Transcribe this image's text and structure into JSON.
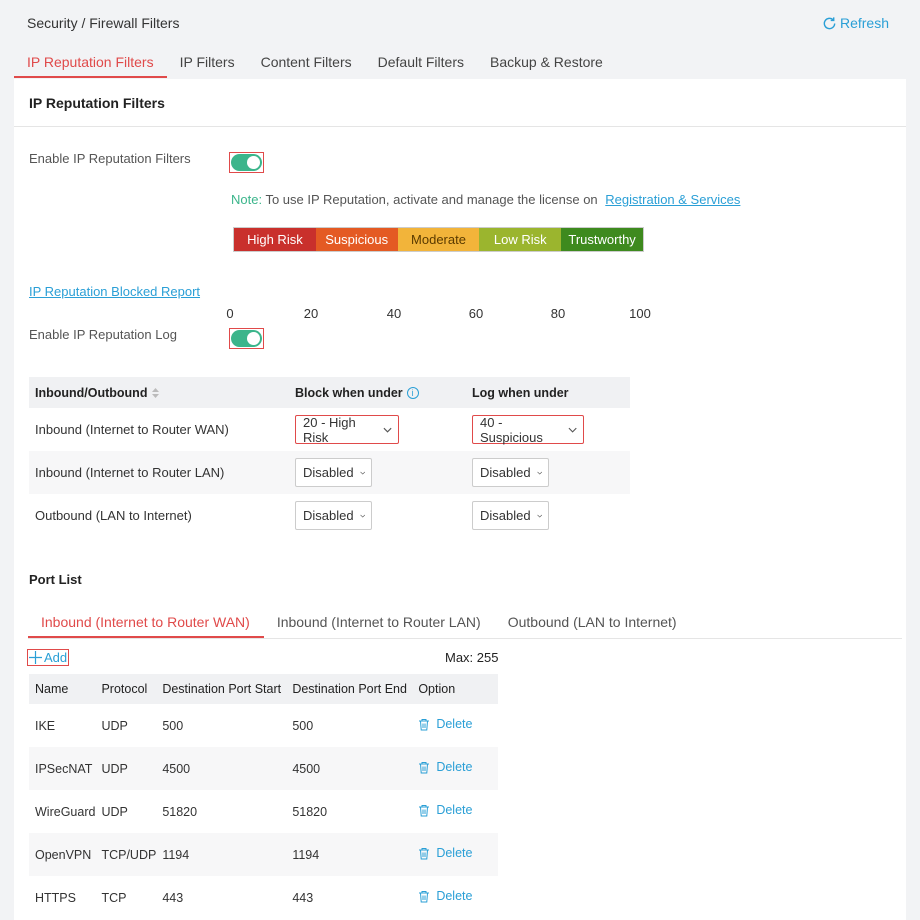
{
  "header": {
    "breadcrumb": "Security / Firewall Filters",
    "refresh_label": "Refresh"
  },
  "tabs": [
    {
      "label": "IP Reputation Filters",
      "active": true
    },
    {
      "label": "IP Filters"
    },
    {
      "label": "Content Filters"
    },
    {
      "label": "Default Filters"
    },
    {
      "label": "Backup & Restore"
    }
  ],
  "panel": {
    "title": "IP Reputation Filters",
    "enable_label": "Enable IP Reputation Filters",
    "enable_on": true,
    "note_key": "Note:",
    "note_text": " To use IP Reputation, activate and manage the license on ",
    "note_link": "Registration & Services",
    "scale": {
      "segments": [
        {
          "label": "High Risk",
          "color": "#c9302c"
        },
        {
          "label": "Suspicious",
          "color": "#e45a23"
        },
        {
          "label": "Moderate",
          "color": "#f2b43a"
        },
        {
          "label": "Low Risk",
          "color": "#9bb52e"
        },
        {
          "label": "Trustworthy",
          "color": "#3e8a1e"
        }
      ],
      "ticks": [
        "0",
        "20",
        "40",
        "60",
        "80",
        "100"
      ]
    },
    "blocked_report_link": "IP Reputation Blocked Report",
    "log_label": "Enable IP Reputation Log",
    "log_on": true
  },
  "reputation_table": {
    "headers": [
      "Inbound/Outbound",
      "Block when under",
      "Log when under"
    ],
    "rows": [
      {
        "direction": "Inbound (Internet to Router WAN)",
        "block": "20 - High Risk",
        "log": "40 - Suspicious"
      },
      {
        "direction": "Inbound (Internet to Router LAN)",
        "block": "Disabled",
        "log": "Disabled"
      },
      {
        "direction": "Outbound (LAN to Internet)",
        "block": "Disabled",
        "log": "Disabled"
      }
    ]
  },
  "port_list": {
    "title": "Port List",
    "tabs": [
      {
        "label": "Inbound (Internet to Router WAN)",
        "active": true
      },
      {
        "label": "Inbound (Internet to Router LAN)"
      },
      {
        "label": "Outbound (LAN to Internet)"
      }
    ],
    "add_label": "Add",
    "max_label": "Max: 255",
    "headers": [
      "Name",
      "Protocol",
      "Destination Port Start",
      "Destination Port End",
      "Option"
    ],
    "delete_label": "Delete",
    "rows": [
      {
        "name": "IKE",
        "protocol": "UDP",
        "start": "500",
        "end": "500"
      },
      {
        "name": "IPSecNAT",
        "protocol": "UDP",
        "start": "4500",
        "end": "4500"
      },
      {
        "name": "WireGuard",
        "protocol": "UDP",
        "start": "51820",
        "end": "51820"
      },
      {
        "name": "OpenVPN",
        "protocol": "TCP/UDP",
        "start": "1194",
        "end": "1194"
      },
      {
        "name": "HTTPS",
        "protocol": "TCP",
        "start": "443",
        "end": "443"
      }
    ]
  }
}
